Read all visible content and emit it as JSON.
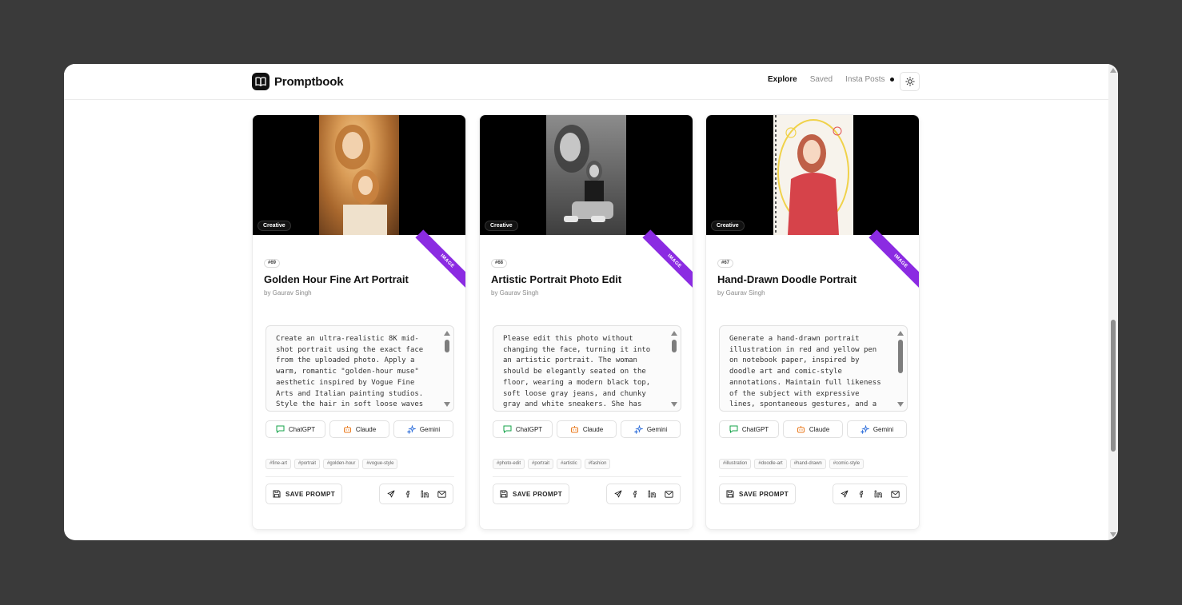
{
  "app": {
    "name": "Promptbook"
  },
  "nav": {
    "links": [
      {
        "label": "Explore"
      },
      {
        "label": "Saved"
      },
      {
        "label": "Insta Posts"
      }
    ]
  },
  "cards": [
    {
      "category": "Creative",
      "badge": "IMAGE",
      "number": "#69",
      "title": "Golden Hour Fine Art Portrait",
      "author": "by Gaurav Singh",
      "prompt": "Create an ultra-realistic 8K mid-shot portrait using the exact face from the uploaded photo. Apply a warm, romantic \"golden-hour muse\" aesthetic inspired by Vogue Fine Arts and Italian painting studios. Style the hair in soft loose waves",
      "ai_buttons": [
        "ChatGPT",
        "Claude",
        "Gemini"
      ],
      "tags": [
        "#fine-art",
        "#portrait",
        "#golden-hour",
        "#vogue-style"
      ],
      "save_label": "SAVE PROMPT"
    },
    {
      "category": "Creative",
      "badge": "IMAGE",
      "number": "#68",
      "title": "Artistic Portrait Photo Edit",
      "author": "by Gaurav Singh",
      "prompt": "Please edit this photo without changing the face, turning it into an artistic portrait. The woman should be elegantly seated on the floor, wearing a modern black top, soft loose gray jeans, and chunky gray and white sneakers. She has",
      "ai_buttons": [
        "ChatGPT",
        "Claude",
        "Gemini"
      ],
      "tags": [
        "#photo-edit",
        "#portrait",
        "#artistic",
        "#fashion"
      ],
      "save_label": "SAVE PROMPT"
    },
    {
      "category": "Creative",
      "badge": "IMAGE",
      "number": "#67",
      "title": "Hand-Drawn Doodle Portrait",
      "author": "by Gaurav Singh",
      "prompt": "Generate a hand-drawn portrait illustration in red and yellow pen on notebook paper, inspired by doodle art and comic-style annotations. Maintain full likeness of the subject with expressive lines, spontaneous gestures, and a",
      "ai_buttons": [
        "ChatGPT",
        "Claude",
        "Gemini"
      ],
      "tags": [
        "#illustration",
        "#doodle-art",
        "#hand-drawn",
        "#comic-style"
      ],
      "save_label": "SAVE PROMPT"
    }
  ]
}
